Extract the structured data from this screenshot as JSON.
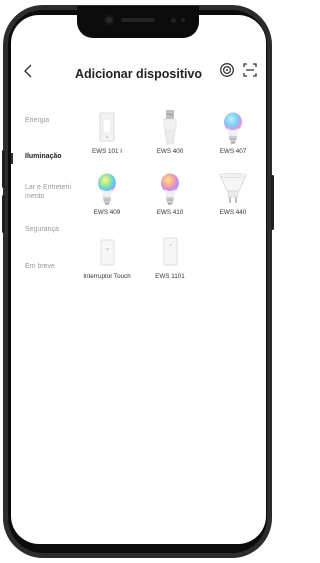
{
  "header": {
    "title": "Adicionar dispositivo"
  },
  "categories": [
    {
      "label": "Energia",
      "active": false
    },
    {
      "label": "Iluminação",
      "active": true
    },
    {
      "label": "Lar e Entretenimento",
      "active": false
    },
    {
      "label": "Segurança",
      "active": false
    },
    {
      "label": "Em breve",
      "active": false
    }
  ],
  "devices": [
    {
      "label": "EWS 101 I",
      "icon": "wall-switch-icon"
    },
    {
      "label": "EWS 400",
      "icon": "bulb-socket-adapter-icon"
    },
    {
      "label": "EWS 407",
      "icon": "rgb-bulb-icon"
    },
    {
      "label": "EWS 409",
      "icon": "rgb-bulb-icon"
    },
    {
      "label": "EWS 410",
      "icon": "rgb-bulb-icon"
    },
    {
      "label": "EWS 440",
      "icon": "spot-bulb-icon"
    },
    {
      "label": "Interruptor Touch",
      "icon": "touch-switch-icon"
    },
    {
      "label": "EWS 1101",
      "icon": "touch-switch-icon"
    }
  ],
  "colors": {
    "frame": "#2c2c2e",
    "text": "#222222",
    "muted": "#9a9a9a"
  }
}
